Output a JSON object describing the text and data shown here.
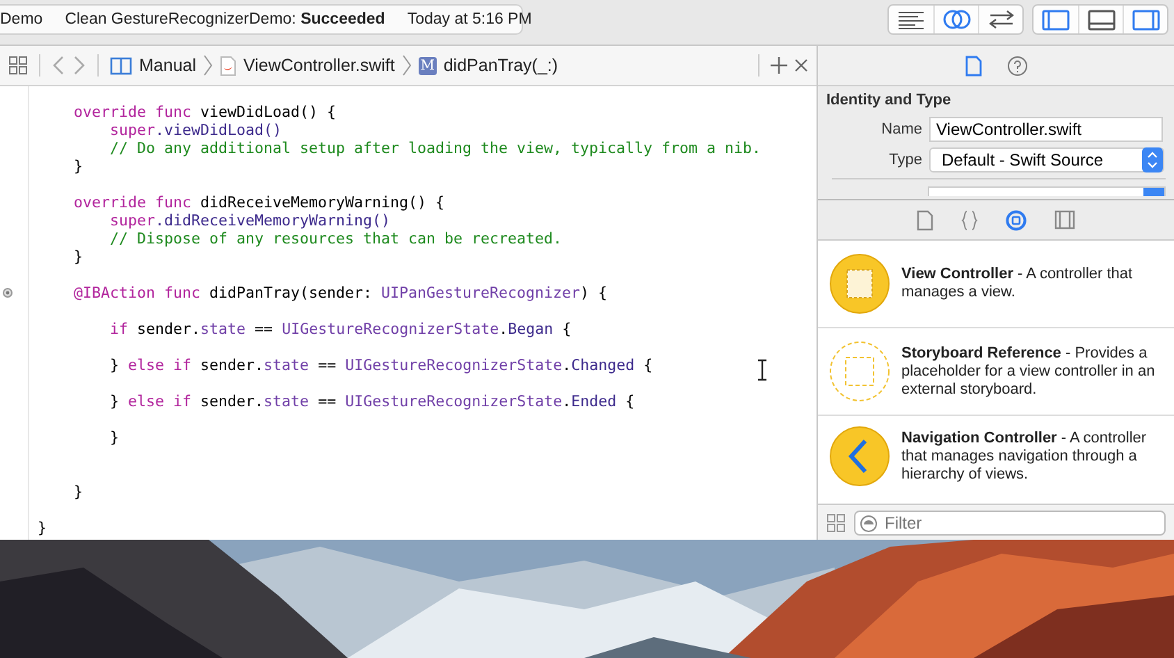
{
  "toolbar": {
    "scheme": "Demo",
    "activity": "Clean GestureRecognizerDemo: **Succeeded**",
    "time": "Today at 5:16 PM",
    "editor_modes": [
      {
        "kind": "standard",
        "selected": false
      },
      {
        "kind": "assistant",
        "selected": true
      },
      {
        "kind": "version",
        "selected": false
      }
    ],
    "panels": [
      {
        "kind": "navigator",
        "selected": true
      },
      {
        "kind": "debug",
        "selected": false
      },
      {
        "kind": "utilities",
        "selected": true
      }
    ]
  },
  "jump_bar": {
    "crumbs": [
      {
        "kind": "group",
        "label": "Manual"
      },
      {
        "kind": "file",
        "label": "ViewController.swift"
      },
      {
        "kind": "method",
        "icon_letter": "M",
        "label": "didPanTray(_:)"
      }
    ]
  },
  "code": {
    "lines": [
      {
        "kind": "code",
        "connected": false,
        "tokens": [
          {
            "kind": "kw",
            "text": "    override func"
          },
          {
            "kind": "plain",
            "text": " viewDidLoad() {"
          }
        ]
      },
      {
        "kind": "code",
        "connected": false,
        "tokens": [
          {
            "kind": "kw",
            "text": "        super"
          },
          {
            "kind": "member",
            "text": ".viewDidLoad()"
          }
        ]
      },
      {
        "kind": "code",
        "connected": false,
        "tokens": [
          {
            "kind": "comment",
            "text": "        // Do any additional setup after loading the view, typically from a nib."
          }
        ]
      },
      {
        "kind": "code",
        "connected": false,
        "tokens": [
          {
            "kind": "plain",
            "text": "    }"
          }
        ]
      },
      {
        "kind": "blank"
      },
      {
        "kind": "code",
        "connected": false,
        "tokens": [
          {
            "kind": "kw",
            "text": "    override func"
          },
          {
            "kind": "plain",
            "text": " didReceiveMemoryWarning() {"
          }
        ]
      },
      {
        "kind": "code",
        "connected": false,
        "tokens": [
          {
            "kind": "kw",
            "text": "        super"
          },
          {
            "kind": "member",
            "text": ".didReceiveMemoryWarning()"
          }
        ]
      },
      {
        "kind": "code",
        "connected": false,
        "tokens": [
          {
            "kind": "comment",
            "text": "        // Dispose of any resources that can be recreated."
          }
        ]
      },
      {
        "kind": "code",
        "connected": false,
        "tokens": [
          {
            "kind": "plain",
            "text": "    }"
          }
        ]
      },
      {
        "kind": "blank"
      },
      {
        "kind": "code",
        "connected": true,
        "tokens": [
          {
            "kind": "kw",
            "text": "    @IBAction func"
          },
          {
            "kind": "plain",
            "text": " didPanTray(sender: "
          },
          {
            "kind": "type",
            "text": "UIPanGestureRecognizer"
          },
          {
            "kind": "plain",
            "text": ") {"
          }
        ]
      },
      {
        "kind": "blank"
      },
      {
        "kind": "code",
        "connected": false,
        "tokens": [
          {
            "kind": "kw",
            "text": "        if"
          },
          {
            "kind": "plain",
            "text": " sender."
          },
          {
            "kind": "type",
            "text": "state"
          },
          {
            "kind": "plain",
            "text": " == "
          },
          {
            "kind": "type",
            "text": "UIGestureRecognizerState"
          },
          {
            "kind": "plain",
            "text": "."
          },
          {
            "kind": "member",
            "text": "Began"
          },
          {
            "kind": "plain",
            "text": " {"
          }
        ]
      },
      {
        "kind": "blank"
      },
      {
        "kind": "code",
        "connected": false,
        "tokens": [
          {
            "kind": "plain",
            "text": "        } "
          },
          {
            "kind": "kw",
            "text": "else if"
          },
          {
            "kind": "plain",
            "text": " sender."
          },
          {
            "kind": "type",
            "text": "state"
          },
          {
            "kind": "plain",
            "text": " == "
          },
          {
            "kind": "type",
            "text": "UIGestureRecognizerState"
          },
          {
            "kind": "plain",
            "text": "."
          },
          {
            "kind": "member",
            "text": "Changed"
          },
          {
            "kind": "plain",
            "text": " {"
          }
        ]
      },
      {
        "kind": "blank"
      },
      {
        "kind": "code",
        "connected": false,
        "tokens": [
          {
            "kind": "plain",
            "text": "        } "
          },
          {
            "kind": "kw",
            "text": "else if"
          },
          {
            "kind": "plain",
            "text": " sender."
          },
          {
            "kind": "type",
            "text": "state"
          },
          {
            "kind": "plain",
            "text": " == "
          },
          {
            "kind": "type",
            "text": "UIGestureRecognizerState"
          },
          {
            "kind": "plain",
            "text": "."
          },
          {
            "kind": "member",
            "text": "Ended"
          },
          {
            "kind": "plain",
            "text": " {"
          }
        ]
      },
      {
        "kind": "blank"
      },
      {
        "kind": "code",
        "connected": false,
        "tokens": [
          {
            "kind": "plain",
            "text": "        }"
          }
        ]
      },
      {
        "kind": "blank"
      },
      {
        "kind": "blank"
      },
      {
        "kind": "code",
        "connected": false,
        "tokens": [
          {
            "kind": "plain",
            "text": "    }"
          }
        ]
      },
      {
        "kind": "blank"
      },
      {
        "kind": "code",
        "connected": false,
        "tokens": [
          {
            "kind": "plain",
            "text": "}"
          }
        ]
      }
    ]
  },
  "inspector": {
    "tabs": [
      {
        "kind": "file",
        "selected": true
      },
      {
        "kind": "help",
        "selected": false
      }
    ],
    "section_title": "Identity and Type",
    "fields": [
      {
        "kind": "text",
        "label": "Name",
        "value": "ViewController.swift"
      },
      {
        "kind": "select",
        "label": "Type",
        "value": "Default - Swift Source"
      }
    ]
  },
  "library": {
    "tabs": [
      {
        "kind": "file",
        "selected": false
      },
      {
        "kind": "braces",
        "selected": false
      },
      {
        "kind": "object",
        "selected": true
      },
      {
        "kind": "media",
        "selected": false
      }
    ],
    "items": [
      {
        "kind": "view-controller",
        "text": "**View Controller** - A controller that manages a view."
      },
      {
        "kind": "storyboard-reference",
        "text": "**Storyboard Reference** - Provides a placeholder for a view controller in an external storyboard."
      },
      {
        "kind": "navigation-controller",
        "text": "**Navigation Controller** - A controller that manages navigation through a hierarchy of views."
      }
    ],
    "filter": {
      "placeholder": "Filter"
    }
  }
}
